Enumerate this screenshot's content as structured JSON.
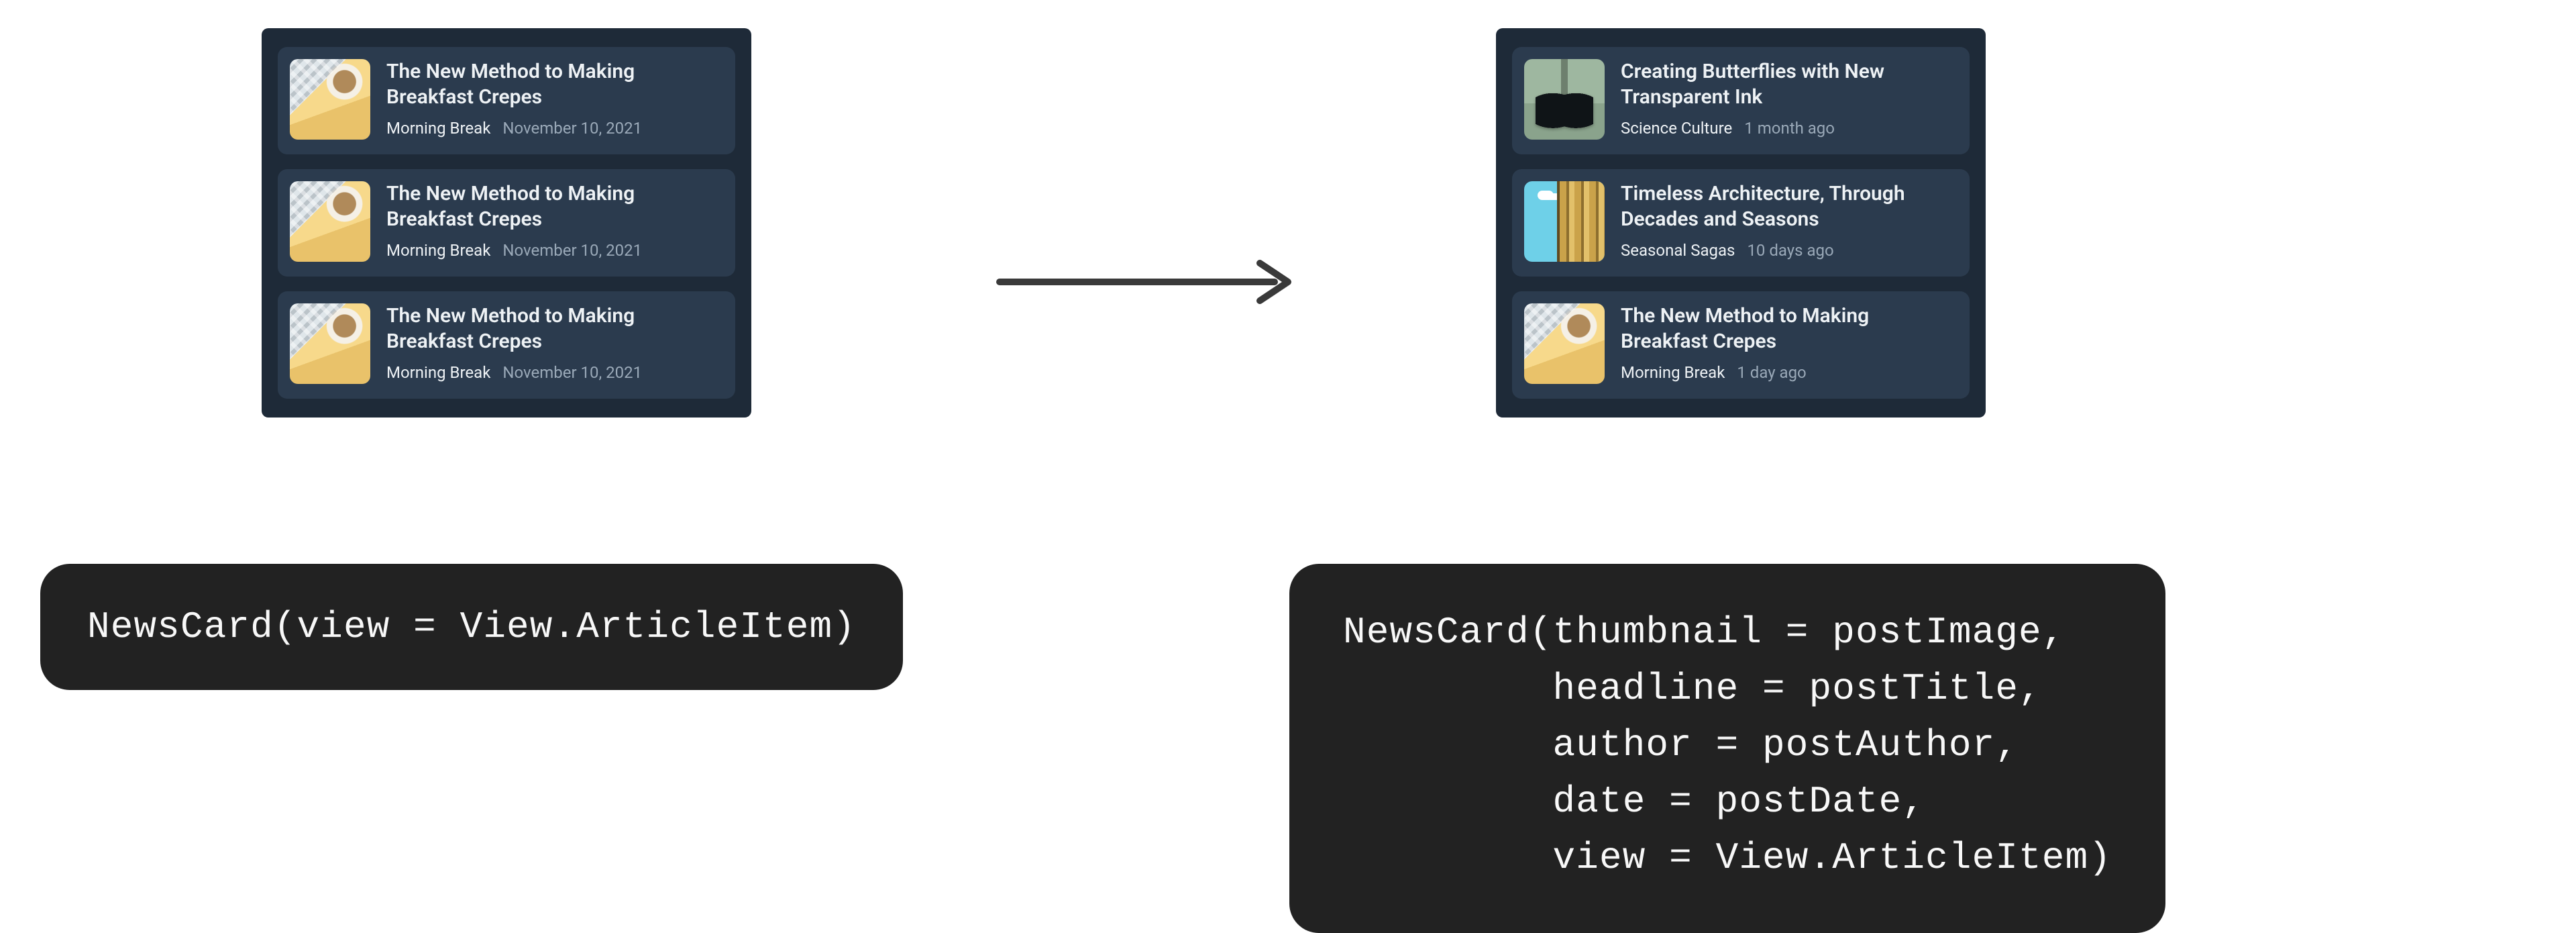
{
  "left": {
    "cards": [
      {
        "thumb": "crepes",
        "headline": "The New Method to Making Breakfast Crepes",
        "author": "Morning Break",
        "date": "November 10, 2021"
      },
      {
        "thumb": "crepes",
        "headline": "The New Method to Making Breakfast Crepes",
        "author": "Morning Break",
        "date": "November 10, 2021"
      },
      {
        "thumb": "crepes",
        "headline": "The New Method to Making Breakfast Crepes",
        "author": "Morning Break",
        "date": "November 10, 2021"
      }
    ],
    "code": "NewsCard(view = View.ArticleItem)"
  },
  "right": {
    "cards": [
      {
        "thumb": "butterfly",
        "headline": "Creating Butterflies with New Transparent Ink",
        "author": "Science Culture",
        "date": "1 month ago"
      },
      {
        "thumb": "arch",
        "headline": "Timeless Architecture, Through Decades and Seasons",
        "author": "Seasonal Sagas",
        "date": "10 days ago"
      },
      {
        "thumb": "crepes",
        "headline": "The New Method to Making Breakfast Crepes",
        "author": "Morning Break",
        "date": "1 day ago"
      }
    ],
    "code_lines": [
      "NewsCard(thumbnail = postImage,",
      "         headline = postTitle,",
      "         author = postAuthor,",
      "         date = postDate,",
      "         view = View.ArticleItem)"
    ]
  },
  "arrow_label": "transforms-to"
}
